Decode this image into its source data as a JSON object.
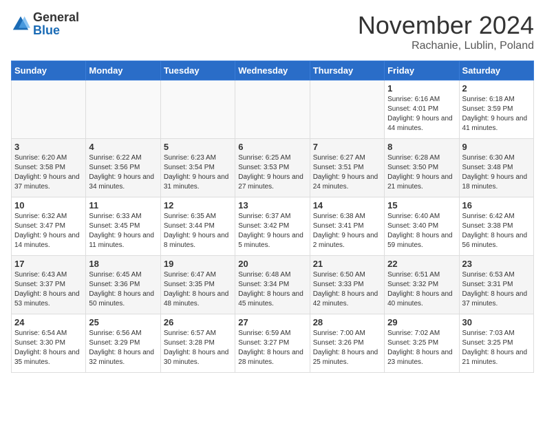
{
  "logo": {
    "text_general": "General",
    "text_blue": "Blue"
  },
  "title": "November 2024",
  "location": "Rachanie, Lublin, Poland",
  "days_of_week": [
    "Sunday",
    "Monday",
    "Tuesday",
    "Wednesday",
    "Thursday",
    "Friday",
    "Saturday"
  ],
  "weeks": [
    [
      {
        "day": "",
        "info": ""
      },
      {
        "day": "",
        "info": ""
      },
      {
        "day": "",
        "info": ""
      },
      {
        "day": "",
        "info": ""
      },
      {
        "day": "",
        "info": ""
      },
      {
        "day": "1",
        "info": "Sunrise: 6:16 AM\nSunset: 4:01 PM\nDaylight: 9 hours and 44 minutes."
      },
      {
        "day": "2",
        "info": "Sunrise: 6:18 AM\nSunset: 3:59 PM\nDaylight: 9 hours and 41 minutes."
      }
    ],
    [
      {
        "day": "3",
        "info": "Sunrise: 6:20 AM\nSunset: 3:58 PM\nDaylight: 9 hours and 37 minutes."
      },
      {
        "day": "4",
        "info": "Sunrise: 6:22 AM\nSunset: 3:56 PM\nDaylight: 9 hours and 34 minutes."
      },
      {
        "day": "5",
        "info": "Sunrise: 6:23 AM\nSunset: 3:54 PM\nDaylight: 9 hours and 31 minutes."
      },
      {
        "day": "6",
        "info": "Sunrise: 6:25 AM\nSunset: 3:53 PM\nDaylight: 9 hours and 27 minutes."
      },
      {
        "day": "7",
        "info": "Sunrise: 6:27 AM\nSunset: 3:51 PM\nDaylight: 9 hours and 24 minutes."
      },
      {
        "day": "8",
        "info": "Sunrise: 6:28 AM\nSunset: 3:50 PM\nDaylight: 9 hours and 21 minutes."
      },
      {
        "day": "9",
        "info": "Sunrise: 6:30 AM\nSunset: 3:48 PM\nDaylight: 9 hours and 18 minutes."
      }
    ],
    [
      {
        "day": "10",
        "info": "Sunrise: 6:32 AM\nSunset: 3:47 PM\nDaylight: 9 hours and 14 minutes."
      },
      {
        "day": "11",
        "info": "Sunrise: 6:33 AM\nSunset: 3:45 PM\nDaylight: 9 hours and 11 minutes."
      },
      {
        "day": "12",
        "info": "Sunrise: 6:35 AM\nSunset: 3:44 PM\nDaylight: 9 hours and 8 minutes."
      },
      {
        "day": "13",
        "info": "Sunrise: 6:37 AM\nSunset: 3:42 PM\nDaylight: 9 hours and 5 minutes."
      },
      {
        "day": "14",
        "info": "Sunrise: 6:38 AM\nSunset: 3:41 PM\nDaylight: 9 hours and 2 minutes."
      },
      {
        "day": "15",
        "info": "Sunrise: 6:40 AM\nSunset: 3:40 PM\nDaylight: 8 hours and 59 minutes."
      },
      {
        "day": "16",
        "info": "Sunrise: 6:42 AM\nSunset: 3:38 PM\nDaylight: 8 hours and 56 minutes."
      }
    ],
    [
      {
        "day": "17",
        "info": "Sunrise: 6:43 AM\nSunset: 3:37 PM\nDaylight: 8 hours and 53 minutes."
      },
      {
        "day": "18",
        "info": "Sunrise: 6:45 AM\nSunset: 3:36 PM\nDaylight: 8 hours and 50 minutes."
      },
      {
        "day": "19",
        "info": "Sunrise: 6:47 AM\nSunset: 3:35 PM\nDaylight: 8 hours and 48 minutes."
      },
      {
        "day": "20",
        "info": "Sunrise: 6:48 AM\nSunset: 3:34 PM\nDaylight: 8 hours and 45 minutes."
      },
      {
        "day": "21",
        "info": "Sunrise: 6:50 AM\nSunset: 3:33 PM\nDaylight: 8 hours and 42 minutes."
      },
      {
        "day": "22",
        "info": "Sunrise: 6:51 AM\nSunset: 3:32 PM\nDaylight: 8 hours and 40 minutes."
      },
      {
        "day": "23",
        "info": "Sunrise: 6:53 AM\nSunset: 3:31 PM\nDaylight: 8 hours and 37 minutes."
      }
    ],
    [
      {
        "day": "24",
        "info": "Sunrise: 6:54 AM\nSunset: 3:30 PM\nDaylight: 8 hours and 35 minutes."
      },
      {
        "day": "25",
        "info": "Sunrise: 6:56 AM\nSunset: 3:29 PM\nDaylight: 8 hours and 32 minutes."
      },
      {
        "day": "26",
        "info": "Sunrise: 6:57 AM\nSunset: 3:28 PM\nDaylight: 8 hours and 30 minutes."
      },
      {
        "day": "27",
        "info": "Sunrise: 6:59 AM\nSunset: 3:27 PM\nDaylight: 8 hours and 28 minutes."
      },
      {
        "day": "28",
        "info": "Sunrise: 7:00 AM\nSunset: 3:26 PM\nDaylight: 8 hours and 25 minutes."
      },
      {
        "day": "29",
        "info": "Sunrise: 7:02 AM\nSunset: 3:25 PM\nDaylight: 8 hours and 23 minutes."
      },
      {
        "day": "30",
        "info": "Sunrise: 7:03 AM\nSunset: 3:25 PM\nDaylight: 8 hours and 21 minutes."
      }
    ]
  ]
}
